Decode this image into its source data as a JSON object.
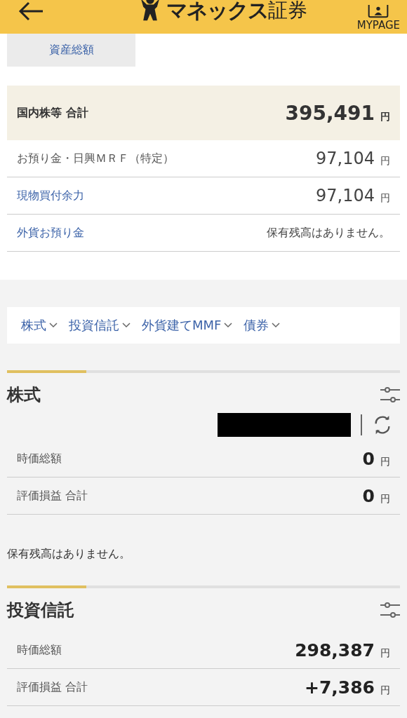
{
  "header": {
    "brand": "マネックス",
    "brand_suffix": "証券",
    "mypage_label": "MYPAGE"
  },
  "tabs": [
    {
      "label": "資産総額",
      "selected": true
    }
  ],
  "summary": {
    "label": "国内株等 合計",
    "value": "395,491",
    "unit": "円"
  },
  "balances": [
    {
      "label": "お預り金・日興ＭＲＦ（特定）",
      "link": false,
      "kind": "amount",
      "value": "97,104",
      "unit": "円"
    },
    {
      "label": "現物買付余力",
      "link": true,
      "kind": "amount",
      "value": "97,104",
      "unit": "円"
    },
    {
      "label": "外貨お預り金",
      "link": true,
      "kind": "message",
      "value": "保有残高はありません。"
    }
  ],
  "nav": [
    "株式",
    "投資信託",
    "外貨建てMMF",
    "債券"
  ],
  "sections": [
    {
      "title": "株式",
      "redacted": true,
      "rows": [
        {
          "label": "時価総額",
          "value": "0",
          "unit": "円"
        },
        {
          "label": "評価損益 合計",
          "value": "0",
          "unit": "円"
        }
      ],
      "note": "保有残高はありません。"
    },
    {
      "title": "投資信託",
      "redacted": false,
      "rows": [
        {
          "label": "時価総額",
          "value": "298,387",
          "unit": "円"
        },
        {
          "label": "評価損益 合計",
          "value": "+7,386",
          "unit": "円"
        }
      ]
    }
  ]
}
